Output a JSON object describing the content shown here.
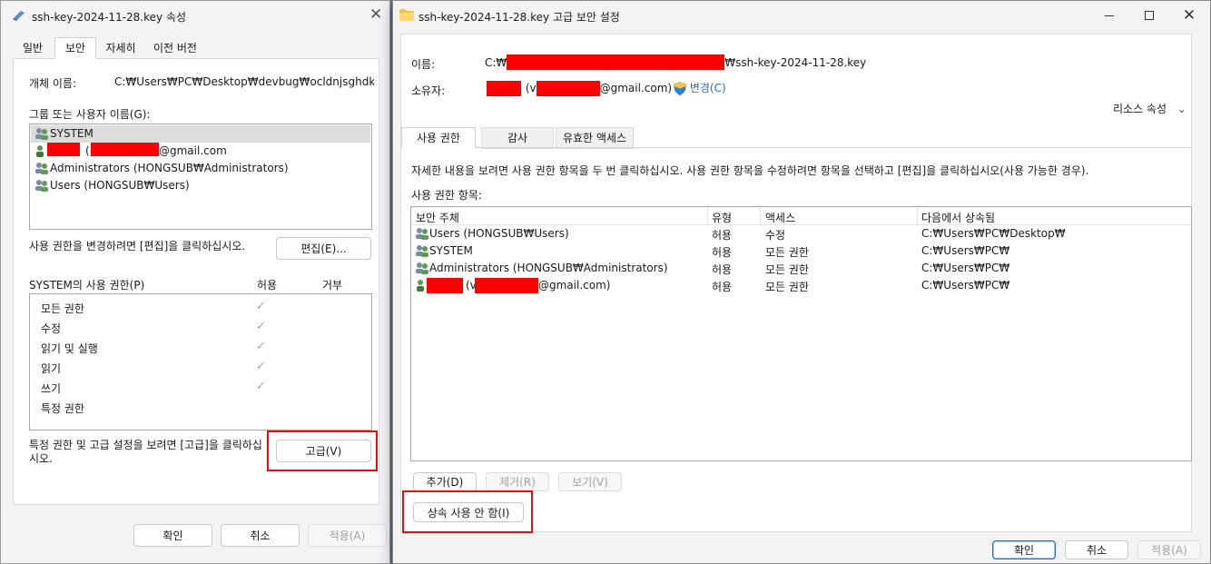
{
  "left_dialog": {
    "title": "ssh-key-2024-11-28.key 속성",
    "tabs": [
      "일반",
      "보안",
      "자세히",
      "이전 버전"
    ],
    "object_name_label": "개체 이름:",
    "object_name_value": "C:₩Users₩PC₩Desktop₩devbug₩ocldnjsghdkey₩ssh",
    "groups_label": "그룹 또는 사용자 이름(G):",
    "users": [
      {
        "name": "SYSTEM"
      },
      {
        "name": "(",
        "suffix": "@gmail.com"
      },
      {
        "name": "Administrators (HONGSUB₩Administrators)"
      },
      {
        "name": "Users (HONGSUB₩Users)"
      }
    ],
    "edit_hint": "사용 권한을 변경하려면 [편집]을 클릭하십시오.",
    "edit_button": "편집(E)...",
    "perm_header": "SYSTEM의 사용 권한(P)",
    "allow_header": "허용",
    "deny_header": "거부",
    "permissions": [
      {
        "name": "모든 권한",
        "allow": "✓"
      },
      {
        "name": "수정",
        "allow": "✓"
      },
      {
        "name": "읽기 및 실행",
        "allow": "✓"
      },
      {
        "name": "읽기",
        "allow": "✓"
      },
      {
        "name": "쓰기",
        "allow": "✓"
      },
      {
        "name": "특정 권한",
        "allow": ""
      }
    ],
    "advanced_hint": "특정 권한 및 고급 설정을 보려면 [고급]을 클릭하십시오.",
    "advanced_button": "고급(V)",
    "ok_button": "확인",
    "cancel_button": "취소",
    "apply_button": "적용(A)"
  },
  "right_dialog": {
    "title": "ssh-key-2024-11-28.key 고급 보안 설정",
    "name_label": "이름:",
    "name_prefix": "C:₩",
    "name_suffix": "₩ssh-key-2024-11-28.key",
    "owner_label": "소유자:",
    "owner_mid": "(v",
    "owner_suffix": "@gmail.com)",
    "change_link": "변경(C)",
    "resource_attr": "리소스 속성",
    "tabs": [
      "사용 권한",
      "감사",
      "유효한 액세스"
    ],
    "info_text": "자세한 내용을 보려면 사용 권한 항목을 두 번 클릭하십시오. 사용 권한 항목을 수정하려면 항목을 선택하고 [편집]을 클릭하십시오(사용 가능한 경우).",
    "entries_label": "사용 권한 항목:",
    "columns": [
      "보안 주체",
      "유형",
      "액세스",
      "다음에서 상속됨"
    ],
    "rows": [
      {
        "principal": "Users (HONGSUB₩Users)",
        "type": "허용",
        "access": "수정",
        "inherited": "C:₩Users₩PC₩Desktop₩"
      },
      {
        "principal": "SYSTEM",
        "type": "허용",
        "access": "모든 권한",
        "inherited": "C:₩Users₩PC₩"
      },
      {
        "principal": "Administrators (HONGSUB₩Administrators)",
        "type": "허용",
        "access": "모든 권한",
        "inherited": "C:₩Users₩PC₩"
      },
      {
        "principal": "(v",
        "principal_suffix": "@gmail.com)",
        "type": "허용",
        "access": "모든 권한",
        "inherited": "C:₩Users₩PC₩"
      }
    ],
    "add_button": "추가(D)",
    "remove_button": "제거(R)",
    "view_button": "보기(V)",
    "disable_inherit_button": "상속 사용 안 함(I)",
    "ok_button": "확인",
    "cancel_button": "취소",
    "apply_button": "적용(A)"
  },
  "colors": {
    "highlight": "#e01010",
    "accent": "#1f6fc5",
    "redaction": "#ff0000"
  }
}
